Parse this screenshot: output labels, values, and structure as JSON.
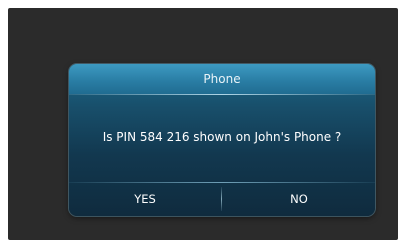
{
  "dialog": {
    "title": "Phone",
    "message": "Is PIN 584 216 shown on John's Phone ?",
    "yes_label": "YES",
    "no_label": "NO"
  },
  "colors": {
    "screen_background": "#2b2b2b",
    "header_blue": "#2a7ea5",
    "body_dark_blue": "#12384f",
    "text": "#ffffff"
  }
}
